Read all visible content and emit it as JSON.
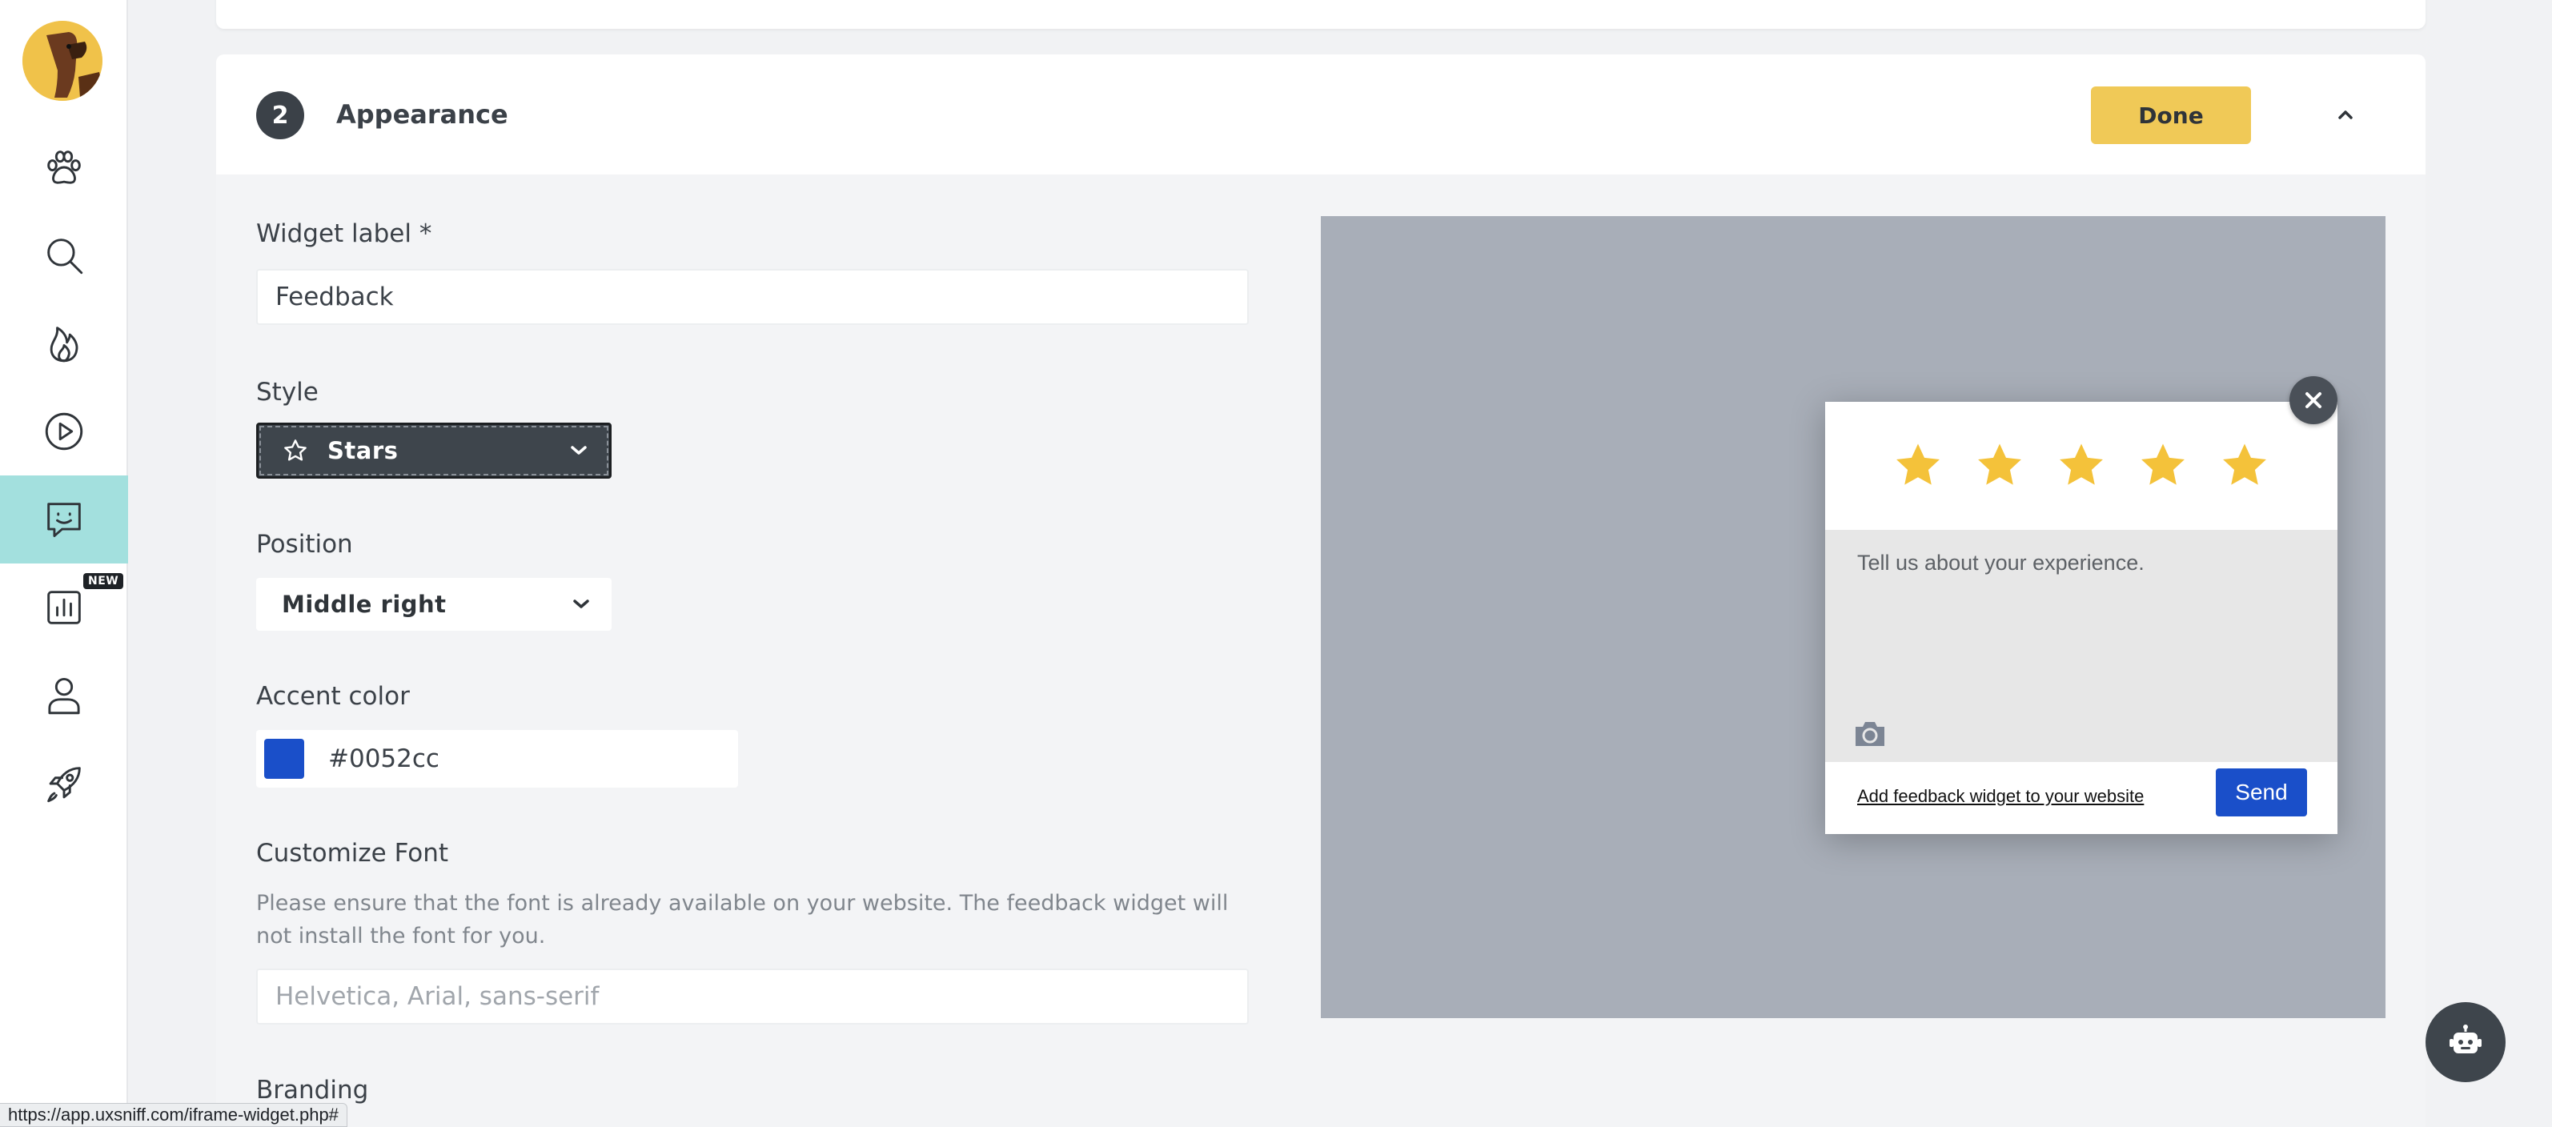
{
  "sidebar": {
    "logo_icon": "dog-logo-icon",
    "items": [
      {
        "icon": "paw-icon",
        "active": false
      },
      {
        "icon": "search-icon",
        "active": false
      },
      {
        "icon": "flame-icon",
        "active": false
      },
      {
        "icon": "play-circle-icon",
        "active": false
      },
      {
        "icon": "feedback-chat-icon",
        "active": true
      },
      {
        "icon": "bar-chart-icon",
        "active": false,
        "badge": "NEW"
      },
      {
        "icon": "user-icon",
        "active": false
      },
      {
        "icon": "rocket-icon",
        "active": false
      }
    ]
  },
  "section": {
    "step": "2",
    "title": "Appearance",
    "done_label": "Done"
  },
  "form": {
    "widget_label": {
      "label": "Widget label *",
      "value": "Feedback"
    },
    "style": {
      "label": "Style",
      "selected": "Stars"
    },
    "position": {
      "label": "Position",
      "selected": "Middle right"
    },
    "accent_color": {
      "label": "Accent color",
      "value": "#0052cc"
    },
    "font": {
      "label": "Customize Font",
      "helper": "Please ensure that the font is already available on your website. The feedback widget will not install the font for you.",
      "placeholder": "Helvetica, Arial, sans-serif"
    },
    "branding_label": "Branding"
  },
  "preview": {
    "stars": 5,
    "star_color": "#f4c23a",
    "textarea_placeholder": "Tell us about your experience.",
    "link_text": "Add feedback widget to your website",
    "send_label": "Send",
    "accent": "#1a4fc9"
  },
  "status_bar": {
    "url": "https://app.uxsniff.com/iframe-widget.php#"
  },
  "colors": {
    "active_nav": "#a3e0de",
    "done_button": "#f0c957",
    "dark": "#3e454c"
  }
}
